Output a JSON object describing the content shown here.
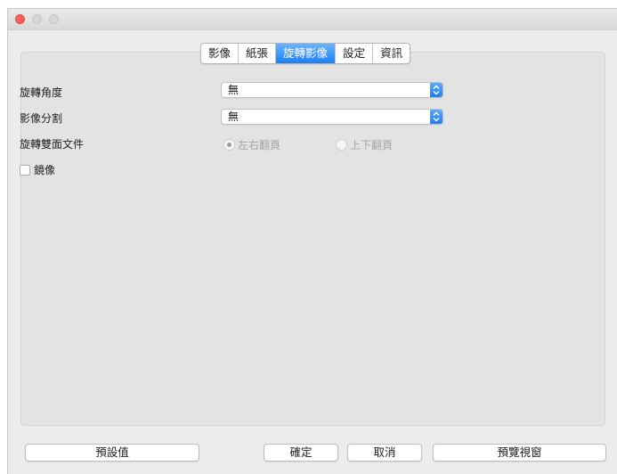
{
  "window": {
    "traffic_lights": {
      "close_color": "#fc615d",
      "inactive_color": "#d6d6d6"
    }
  },
  "tabs": [
    {
      "label": "影像",
      "active": false
    },
    {
      "label": "紙張",
      "active": false
    },
    {
      "label": "旋轉影像",
      "active": true
    },
    {
      "label": "設定",
      "active": false
    },
    {
      "label": "資訊",
      "active": false
    }
  ],
  "form": {
    "rotation_angle": {
      "label": "旋轉角度",
      "value": "無"
    },
    "image_split": {
      "label": "影像分割",
      "value": "無"
    },
    "rotate_duplex": {
      "label": "旋轉雙面文件",
      "options": [
        {
          "label": "左右翻頁",
          "selected": true,
          "enabled": false
        },
        {
          "label": "上下翻頁",
          "selected": false,
          "enabled": false
        }
      ]
    },
    "mirror": {
      "label": "鏡像",
      "checked": false
    }
  },
  "buttons": {
    "defaults": "預設值",
    "ok": "確定",
    "cancel": "取消",
    "preview": "預覽視窗"
  },
  "colors": {
    "accent": "#1b7ef5",
    "panel_bg": "#e3e3e3",
    "window_bg": "#ececec"
  }
}
